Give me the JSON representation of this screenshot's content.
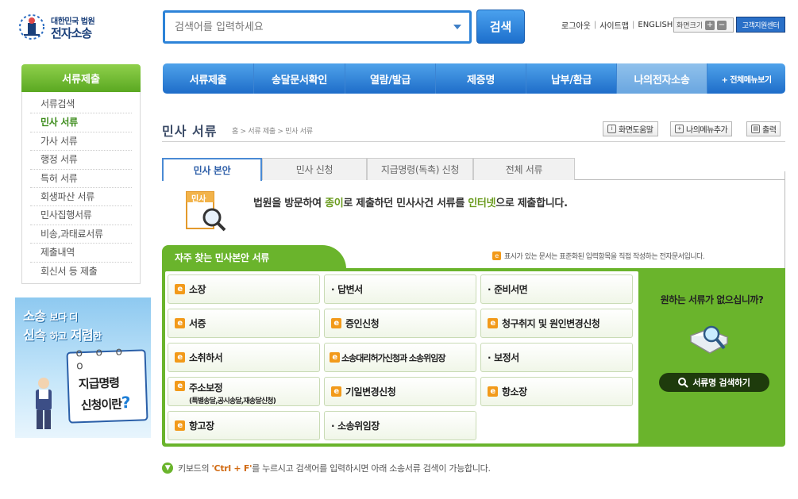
{
  "logo": {
    "line1": "대한민국 법원",
    "line2": "전자소송"
  },
  "search": {
    "placeholder": "검색어를 입력하세요",
    "button": "검색"
  },
  "util": {
    "logout": "로그아웃",
    "sitemap": "사이트맵",
    "english": "ENGLISH",
    "fontsize": "화면크기",
    "plus": "+",
    "minus": "−",
    "support": "고객지원센터"
  },
  "gnb": {
    "items": [
      "서류제출",
      "송달문서확인",
      "열람/발급",
      "제증명",
      "납부/환급",
      "나의전자소송"
    ],
    "all": "+ 전체메뉴보기"
  },
  "sidebar": {
    "title": "서류제출",
    "items": [
      "서류검색",
      "민사 서류",
      "가사 서류",
      "행정 서류",
      "특허 서류",
      "회생파산 서류",
      "민사집행서류",
      "비송,과태료서류",
      "제출내역",
      "회신서 등 제출"
    ]
  },
  "banner": {
    "a": "소송",
    "b": "보다 더",
    "c": "신속",
    "d": "하고",
    "e": "저렴",
    "f": "한",
    "g": "지급명령",
    "h": "신청이란",
    "q": "?"
  },
  "page": {
    "title": "민사 서류",
    "breadcrumb": "홈 > 서류 제출 > 민사 서류",
    "help": "화면도움말",
    "mymenu": "나의메뉴추가",
    "print": "출력"
  },
  "tabs": [
    "민사 본안",
    "민사 신청",
    "지급명령(독촉) 신청",
    "전체 서류"
  ],
  "intro": {
    "pre": "법원을 방문하여 ",
    "paper": "종이",
    "mid": "로 제출하던 민사사건 서류를 ",
    "net": "인터넷",
    "post": "으로 제출합니다.",
    "icon_label": "민사"
  },
  "panel": {
    "title": "자주 찾는 민사본안 서류",
    "note": "표시가 있는 문서는 표준화된 입력항목을 직접 작성하는 전자문서입니다.",
    "docs": [
      {
        "label": "소장",
        "e": true
      },
      {
        "label": "답변서",
        "e": false
      },
      {
        "label": "준비서면",
        "e": false
      },
      {
        "label": "서증",
        "e": true
      },
      {
        "label": "증인신청",
        "e": true
      },
      {
        "label": "청구취지 및 원인변경신청",
        "e": true
      },
      {
        "label": "소취하서",
        "e": true
      },
      {
        "label": "소송대리허가신청과 소송위임장",
        "e": true
      },
      {
        "label": "보정서",
        "e": false
      },
      {
        "label": "주소보정",
        "sub": "(특별송달,공시송달,재송달신청)",
        "e": true
      },
      {
        "label": "기일변경신청",
        "e": true
      },
      {
        "label": "항소장",
        "e": true
      },
      {
        "label": "항고장",
        "e": true
      },
      {
        "label": "소송위임장",
        "e": false
      }
    ],
    "want": "원하는 서류가 없으십니까?",
    "find": "서류명 검색하기"
  },
  "footer": {
    "pre": "키보드의 ",
    "keys": "'Ctrl + F'",
    "post": "를 누르시고 검색어를 입력하시면 아래 소송서류 검색이 가능합니다."
  },
  "colors": {
    "green": "#6ab42c",
    "blue": "#1e6dc9",
    "orange": "#f29a1a"
  }
}
